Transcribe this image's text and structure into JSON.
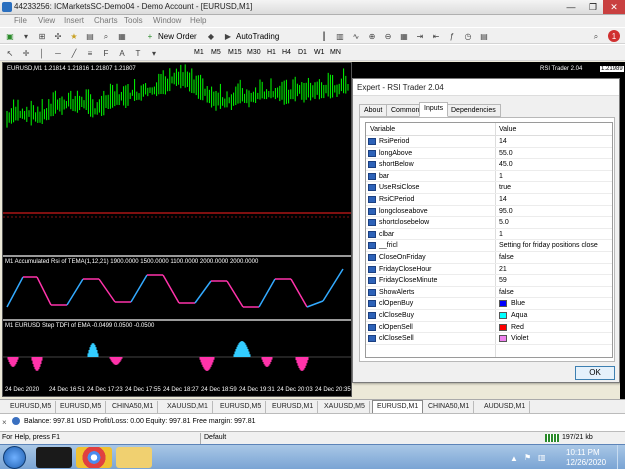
{
  "window": {
    "title": "44233256: ICMarketsSC-Demo04 - Demo Account - [EURUSD,M1]"
  },
  "menu": [
    "File",
    "View",
    "Insert",
    "Charts",
    "Tools",
    "Window",
    "Help"
  ],
  "toolbar": {
    "new_order": "New Order",
    "autotrading": "AutoTrading",
    "timeframes": [
      "M1",
      "M5",
      "M15",
      "M30",
      "H1",
      "H4",
      "D1",
      "W1",
      "MN"
    ]
  },
  "chart": {
    "main_label": "EURUSD,M1  1.21814 1.21816 1.21807 1.21807",
    "ea_label": "RSI Trader 2.04",
    "price_label": "1.21989",
    "sub1_label": "M1 Accumulated Rsi of TEMA(1,12,21) 1900.0000 1500.0000 1100.0000 2000.0000 2000.0000",
    "sub2_label": "M1 EURUSD Step TDFI of EMA -0.0499 0.0500 -0.0500",
    "time_labels": [
      "24 Dec 2020",
      "24 Dec 16:51",
      "24 Dec 17:23",
      "24 Dec 17:55",
      "24 Dec 18:27",
      "24 Dec 18:59",
      "24 Dec 19:31",
      "24 Dec 20:03",
      "24 Dec 20:35"
    ],
    "colors": {
      "candles": "#00ff00",
      "level_line": "#ff2020",
      "rsi_up": "#33aaff",
      "rsi_down": "#ff33aa",
      "tdfi_up": "#33ccff",
      "tdfi_down": "#ff33aa"
    }
  },
  "dialog": {
    "title": "Expert - RSI Trader 2.04",
    "tabs": [
      "About",
      "Common",
      "Inputs",
      "Dependencies"
    ],
    "active_tab": "Inputs",
    "col_variable": "Variable",
    "col_value": "Value",
    "ok": "OK",
    "rows": [
      {
        "name": "RsiPeriod",
        "value": "14"
      },
      {
        "name": "longAbove",
        "value": "55.0"
      },
      {
        "name": "shortBelow",
        "value": "45.0"
      },
      {
        "name": "bar",
        "value": "1"
      },
      {
        "name": "UseRsiClose",
        "value": "true"
      },
      {
        "name": "RsiCPeriod",
        "value": "14"
      },
      {
        "name": "longcloseabove",
        "value": "95.0"
      },
      {
        "name": "shortclosebelow",
        "value": "5.0"
      },
      {
        "name": "clbar",
        "value": "1"
      },
      {
        "name": "__fricl",
        "value": "Setting for friday positions close"
      },
      {
        "name": "CloseOnFriday",
        "value": "false"
      },
      {
        "name": "FridayCloseHour",
        "value": "21"
      },
      {
        "name": "FridayCloseMinute",
        "value": "59"
      },
      {
        "name": "ShowAlerts",
        "value": "false"
      },
      {
        "name": "clOpenBuy",
        "value": "Blue",
        "color": "#0000ff"
      },
      {
        "name": "clCloseBuy",
        "value": "Aqua",
        "color": "#00ffff"
      },
      {
        "name": "clOpenSell",
        "value": "Red",
        "color": "#ff0000"
      },
      {
        "name": "clCloseSell",
        "value": "Violet",
        "color": "#ee82ee"
      }
    ]
  },
  "symbol_tabs": [
    "EURUSD,M5",
    "EURUSD,M5",
    "CHINA50,M1",
    "XAUUSD,M1",
    "EURUSD,M5",
    "EURUSD,M1",
    "XAUUSD,M5",
    "EURUSD,M1",
    "CHINA50,M1",
    "AUDUSD,M1"
  ],
  "active_symbol_tab": 7,
  "terminal": {
    "balance_text": "Balance: 997.81 USD  Profit/Loss: 0.00  Equity: 997.81  Free margin: 997.81"
  },
  "status": {
    "help": "For Help, press F1",
    "profile": "Default",
    "traffic": "197/21 kb"
  },
  "taskbar": {
    "time": "10:11 PM",
    "date": "12/26/2020"
  }
}
